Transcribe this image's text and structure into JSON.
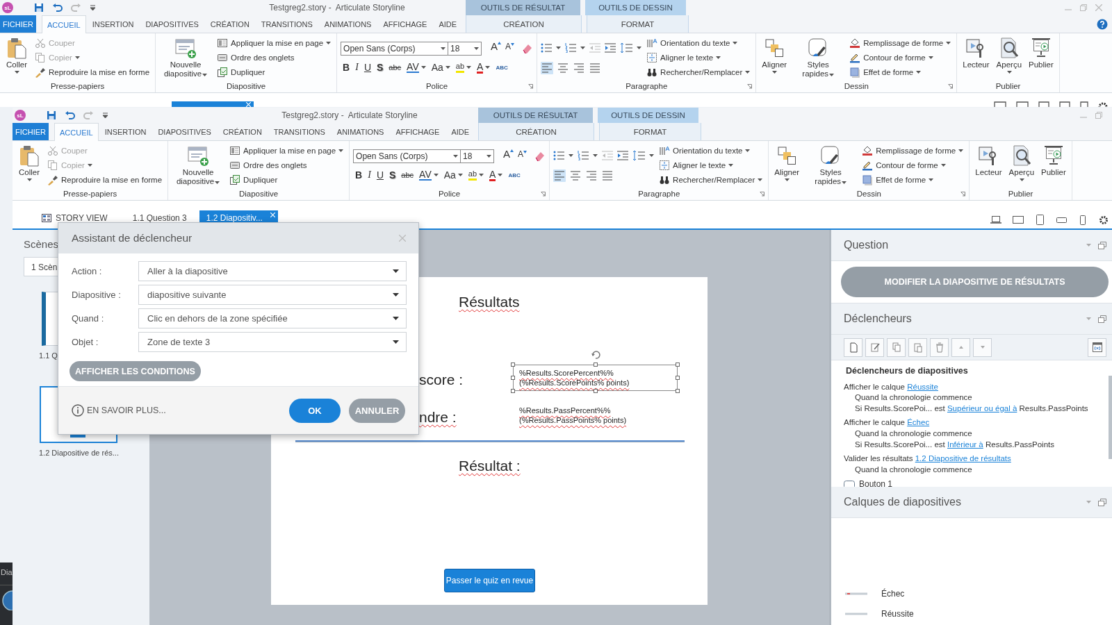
{
  "back_window": {
    "logo": "sL",
    "title": "Testgreg2.story -  Articulate Storyline",
    "ribbon": {
      "file_tab": "FICHIER",
      "tabs": [
        {
          "label": "ACCUEIL",
          "selected": true
        },
        {
          "label": "INSERTION",
          "selected": false
        },
        {
          "label": "DIAPOSITIVES",
          "selected": false
        },
        {
          "label": "CRÉATION",
          "selected": false
        },
        {
          "label": "TRANSITIONS",
          "selected": false
        },
        {
          "label": "ANIMATIONS",
          "selected": false
        },
        {
          "label": "AFFICHAGE",
          "selected": false
        },
        {
          "label": "AIDE",
          "selected": false
        }
      ],
      "context_tabs": [
        {
          "group": "OUTILS DE RÉSULTAT",
          "label": "CRÉATION",
          "selected": false
        },
        {
          "group": "OUTILS DE DESSIN",
          "label": "FORMAT",
          "selected": false
        }
      ],
      "groups": [
        {
          "kind": "buttons",
          "label": "Presse-papiers",
          "launcher": false,
          "large": [
            {
              "kind": "paste",
              "label": "Coller",
              "dropdown": true
            }
          ],
          "small": [
            {
              "kind": "scissors",
              "label": "Couper",
              "dropdown": false,
              "disabled": true
            },
            {
              "kind": "copy",
              "label": "Copier",
              "dropdown": true,
              "disabled": true
            },
            {
              "kind": "brush",
              "label": "Reproduire la mise en forme",
              "dropdown": false,
              "disabled": false
            }
          ]
        },
        {
          "kind": "buttons",
          "label": "Diapositive",
          "launcher": false,
          "large": [
            {
              "kind": "new-slide",
              "label": "Nouvelle diapositive",
              "dropdown": true
            }
          ],
          "small": [
            {
              "kind": "layout",
              "label": "Appliquer la mise en page",
              "dropdown": true
            },
            {
              "kind": "tab-order",
              "label": "Ordre des onglets",
              "dropdown": false
            },
            {
              "kind": "duplicate",
              "label": "Dupliquer",
              "dropdown": false
            }
          ]
        },
        {
          "kind": "font",
          "label": "Police",
          "launcher": true,
          "font_name": "Open Sans (Corps)",
          "font_size": "18",
          "size_buttons": [
            "A",
            "A"
          ],
          "format_buttons": [
            {
              "kind": "bold",
              "label": "B"
            },
            {
              "kind": "italic",
              "label": "I"
            },
            {
              "kind": "underline",
              "label": "U"
            },
            {
              "kind": "shadow",
              "label": "S"
            },
            {
              "kind": "strike",
              "label": "abc"
            },
            {
              "kind": "spacing",
              "label": "AV"
            },
            {
              "kind": "case",
              "label": "Aa"
            },
            {
              "kind": "highlight",
              "label": "ab"
            },
            {
              "kind": "color",
              "label": "A"
            },
            {
              "kind": "spell",
              "label": "ABC"
            }
          ]
        },
        {
          "kind": "paragraph",
          "label": "Paragraphe",
          "launcher": true,
          "alignments": [
            {
              "selected": true
            },
            {
              "selected": false
            },
            {
              "selected": false
            },
            {
              "selected": false
            }
          ],
          "small": [
            {
              "kind": "text-direction",
              "label": "Orientation du texte",
              "dropdown": true
            },
            {
              "kind": "align-text",
              "label": "Aligner le texte",
              "dropdown": true
            },
            {
              "kind": "binoculars",
              "label": "Rechercher/Remplacer",
              "dropdown": true
            }
          ]
        },
        {
          "kind": "buttons",
          "label": "Dessin",
          "launcher": true,
          "large": [
            {
              "kind": "arrange",
              "label": "Aligner",
              "dropdown": true
            },
            {
              "kind": "styles",
              "label": "Styles rapides",
              "dropdown": true
            }
          ],
          "small": [
            {
              "kind": "fill",
              "label": "Remplissage de forme",
              "dropdown": true
            },
            {
              "kind": "outline",
              "label": "Contour de forme",
              "dropdown": true
            },
            {
              "kind": "effect",
              "label": "Effet de forme",
              "dropdown": true
            }
          ]
        },
        {
          "kind": "buttons",
          "label": "Publier",
          "launcher": false,
          "large": [
            {
              "kind": "player",
              "label": "Lecteur",
              "dropdown": false
            },
            {
              "kind": "preview",
              "label": "Aperçu",
              "dropdown": true
            },
            {
              "kind": "publish",
              "label": "Publier",
              "dropdown": false
            }
          ]
        }
      ]
    }
  },
  "front_window": {
    "logo": "sL",
    "title": "Testgreg2.story -  Articulate Storyline",
    "ribbon": {
      "file_tab": "FICHIER",
      "tabs": [
        {
          "label": "ACCUEIL",
          "selected": true
        },
        {
          "label": "INSERTION",
          "selected": false
        },
        {
          "label": "DIAPOSITIVES",
          "selected": false
        },
        {
          "label": "CRÉATION",
          "selected": false
        },
        {
          "label": "TRANSITIONS",
          "selected": false
        },
        {
          "label": "ANIMATIONS",
          "selected": false
        },
        {
          "label": "AFFICHAGE",
          "selected": false
        },
        {
          "label": "AIDE",
          "selected": false
        }
      ],
      "context_tabs": [
        {
          "group": "OUTILS DE RÉSULTAT",
          "label": "CRÉATION",
          "selected": false
        },
        {
          "group": "OUTILS DE DESSIN",
          "label": "FORMAT",
          "selected": false
        }
      ],
      "groups": [
        {
          "kind": "buttons",
          "label": "Presse-papiers",
          "launcher": false,
          "large": [
            {
              "kind": "paste",
              "label": "Coller",
              "dropdown": true
            }
          ],
          "small": [
            {
              "kind": "scissors",
              "label": "Couper",
              "dropdown": false,
              "disabled": true
            },
            {
              "kind": "copy",
              "label": "Copier",
              "dropdown": true,
              "disabled": true
            },
            {
              "kind": "brush",
              "label": "Reproduire la mise en forme",
              "dropdown": false,
              "disabled": false
            }
          ]
        },
        {
          "kind": "buttons",
          "label": "Diapositive",
          "launcher": false,
          "large": [
            {
              "kind": "new-slide",
              "label": "Nouvelle diapositive",
              "dropdown": true
            }
          ],
          "small": [
            {
              "kind": "layout",
              "label": "Appliquer la mise en page",
              "dropdown": true
            },
            {
              "kind": "tab-order",
              "label": "Ordre des onglets",
              "dropdown": false
            },
            {
              "kind": "duplicate",
              "label": "Dupliquer",
              "dropdown": false
            }
          ]
        },
        {
          "kind": "font",
          "label": "Police",
          "launcher": true,
          "font_name": "Open Sans (Corps)",
          "font_size": "18",
          "size_buttons": [
            "A",
            "A"
          ],
          "format_buttons": [
            {
              "kind": "bold",
              "label": "B"
            },
            {
              "kind": "italic",
              "label": "I"
            },
            {
              "kind": "underline",
              "label": "U"
            },
            {
              "kind": "shadow",
              "label": "S"
            },
            {
              "kind": "strike",
              "label": "abc"
            },
            {
              "kind": "spacing",
              "label": "AV"
            },
            {
              "kind": "case",
              "label": "Aa"
            },
            {
              "kind": "highlight",
              "label": "ab"
            },
            {
              "kind": "color",
              "label": "A"
            },
            {
              "kind": "spell",
              "label": "ABC"
            }
          ]
        },
        {
          "kind": "paragraph",
          "label": "Paragraphe",
          "launcher": true,
          "alignments": [
            {
              "selected": true
            },
            {
              "selected": false
            },
            {
              "selected": false
            },
            {
              "selected": false
            }
          ],
          "small": [
            {
              "kind": "text-direction",
              "label": "Orientation du texte",
              "dropdown": true
            },
            {
              "kind": "align-text",
              "label": "Aligner le texte",
              "dropdown": true
            },
            {
              "kind": "binoculars",
              "label": "Rechercher/Remplacer",
              "dropdown": true
            }
          ]
        },
        {
          "kind": "buttons",
          "label": "Dessin",
          "launcher": true,
          "large": [
            {
              "kind": "arrange",
              "label": "Aligner",
              "dropdown": true
            },
            {
              "kind": "styles",
              "label": "Styles rapides",
              "dropdown": true
            }
          ],
          "small": [
            {
              "kind": "fill",
              "label": "Remplissage de forme",
              "dropdown": true
            },
            {
              "kind": "outline",
              "label": "Contour de forme",
              "dropdown": true
            },
            {
              "kind": "effect",
              "label": "Effet de forme",
              "dropdown": true
            }
          ]
        },
        {
          "kind": "buttons",
          "label": "Publier",
          "launcher": false,
          "large": [
            {
              "kind": "player",
              "label": "Lecteur",
              "dropdown": false
            },
            {
              "kind": "preview",
              "label": "Aperçu",
              "dropdown": true
            },
            {
              "kind": "publish",
              "label": "Publier",
              "dropdown": false
            }
          ]
        }
      ]
    },
    "story_tabs": [
      {
        "label": "STORY VIEW",
        "selected": false
      },
      {
        "label": "1.1 Question 3",
        "selected": false
      },
      {
        "label": "1.2 Diapositiv...",
        "selected": true
      }
    ],
    "scenes_panel": {
      "title": "Scènes",
      "scene_field": "1 Scèn",
      "slides": [
        {
          "label": "1.1 Q",
          "selected": false
        },
        {
          "label": "1.2 Diapositive de rés...",
          "selected": true
        }
      ]
    },
    "slide": {
      "title": "Résultats",
      "score_label": "score :",
      "score_value": {
        "lines": [
          "%Results.ScorePercent%%",
          "(%Results.ScorePoints% points)"
        ],
        "selected": true
      },
      "pass_label": "ndre :",
      "pass_value": {
        "lines": [
          "%Results.PassPercent%%",
          "(%Results.PassPoints% points)"
        ],
        "selected": false
      },
      "result_label": "Résultat :",
      "review_button": "Passer le quiz en revue"
    },
    "right_panel": {
      "question": {
        "title": "Question",
        "button": "MODIFIER LA DIAPOSITIVE DE RÉSULTATS"
      },
      "triggers": {
        "title": "Déclencheurs",
        "section": "Déclencheurs de diapositives",
        "items": [
          {
            "action": "Afficher le calque",
            "target": "Réussite",
            "conditions": [
              [
                {
                  "text": "Quand la chronologie commence",
                  "link": false
                }
              ],
              [
                {
                  "text": "Si Results.ScorePoi... est",
                  "link": false
                },
                {
                  "text": "Supérieur ou égal à",
                  "link": true
                },
                {
                  "text": "Results.PassPoints",
                  "link": false
                }
              ]
            ]
          },
          {
            "action": "Afficher le calque",
            "target": "Échec",
            "conditions": [
              [
                {
                  "text": "Quand la chronologie commence",
                  "link": false
                }
              ],
              [
                {
                  "text": "Si Results.ScorePoi... est",
                  "link": false
                },
                {
                  "text": "Inférieur à",
                  "link": true
                },
                {
                  "text": "Results.PassPoints",
                  "link": false
                }
              ]
            ]
          },
          {
            "action": "Valider les résultats",
            "target": "1.2 Diapositive de résultats",
            "conditions": [
              [
                {
                  "text": "Quand la chronologie commence",
                  "link": false
                }
              ]
            ]
          }
        ],
        "object": "Bouton 1"
      },
      "layers": {
        "title": "Calques de diapositives",
        "items": [
          {
            "label": "Échec"
          },
          {
            "label": "Réussite"
          }
        ]
      }
    }
  },
  "trigger_dialog": {
    "title": "Assistant de déclencheur",
    "fields": [
      {
        "label": "Action :",
        "value": "Aller à la diapositive"
      },
      {
        "label": "Diapositive :",
        "value": "diapositive suivante"
      },
      {
        "label": "Quand :",
        "value": "Clic en dehors de la zone spécifiée"
      },
      {
        "label": "Objet :",
        "value": "Zone de texte 3"
      }
    ],
    "conditions_button": "AFFICHER LES CONDITIONS",
    "help_link": "EN SAVOIR PLUS...",
    "ok": "OK",
    "cancel": "ANNULER"
  },
  "taskbar": {
    "label": "Dia"
  }
}
